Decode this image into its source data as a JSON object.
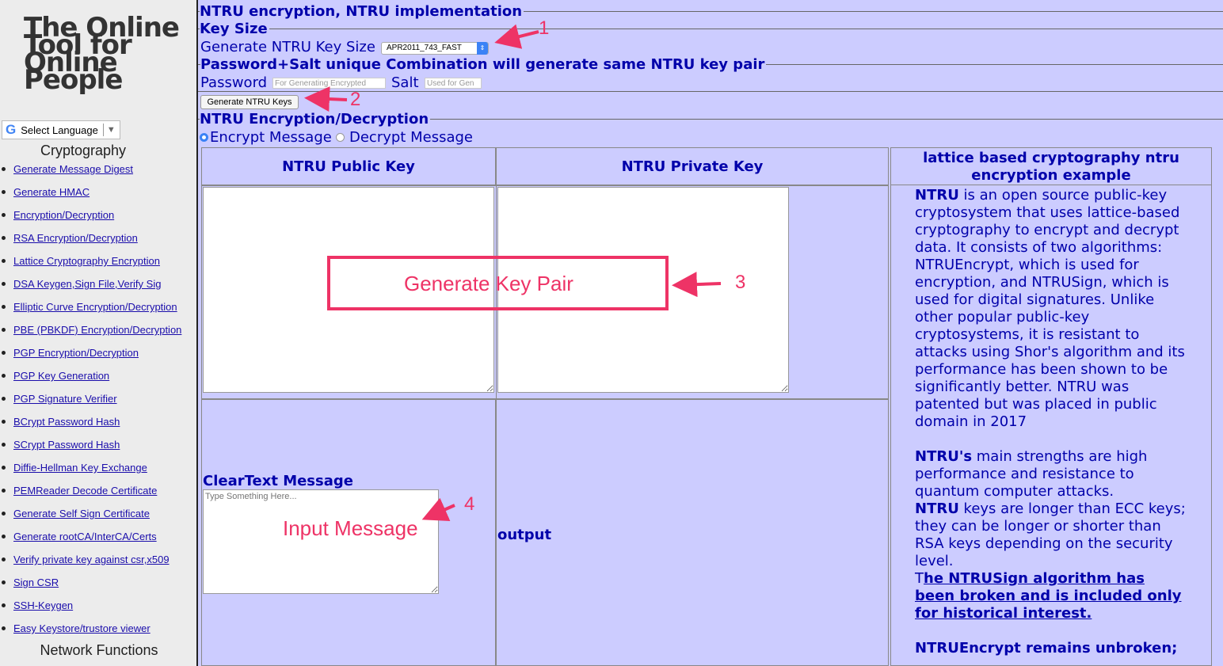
{
  "sidebar": {
    "logo_lines": [
      "The Online",
      "Tool for",
      "Online",
      "People"
    ],
    "language_label": "Select Language",
    "sections": [
      {
        "title": "Cryptography"
      },
      {
        "title": "Network Functions"
      }
    ],
    "items": [
      "Generate Message Digest",
      "Generate HMAC",
      "Encryption/Decryption",
      "RSA Encryption/Decryption",
      "Lattice Cryptography Encryption",
      "DSA Keygen,Sign File,Verify Sig",
      "Elliptic Curve Encryption/Decryption",
      "PBE (PBKDF) Encryption/Decryption",
      "PGP Encryption/Decryption",
      "PGP Key Generation",
      "PGP Signature Verifier",
      "BCrypt Password Hash",
      "SCrypt Password Hash",
      "Diffie-Hellman Key Exchange",
      "PEMReader Decode Certificate",
      "Generate Self Sign Certificate",
      "Generate rootCA/InterCA/Certs",
      "Verify private key against csr,x509",
      "Sign CSR",
      "SSH-Keygen",
      "Easy Keystore/trustore viewer"
    ]
  },
  "main": {
    "heading": "NTRU encryption, NTRU implementation",
    "key_size": {
      "legend": "Key Size",
      "label": "Generate NTRU Key Size",
      "selected": "APR2011_743_FAST"
    },
    "password_section": {
      "legend": "Password+Salt unique Combination will generate same NTRU key pair",
      "password_label": "Password",
      "password_placeholder": "For Generating Encrypted",
      "salt_label": "Salt",
      "salt_placeholder": "Used for Gen"
    },
    "generate_button": "Generate NTRU Keys",
    "encdec": {
      "legend": "NTRU Encryption/Decryption",
      "encrypt_label": "Encrypt Message",
      "decrypt_label": "Decrypt Message",
      "mode": "encrypt"
    },
    "table": {
      "public_key_header": "NTRU Public Key",
      "private_key_header": "NTRU Private Key",
      "info_header": "lattice based cryptography ntru encryption example",
      "cleartext_label": "ClearText Message",
      "cleartext_placeholder": "Type Something Here...",
      "output_label": "output"
    },
    "description": {
      "p1_bold": "NTRU",
      "p1": " is an open source public-key cryptosystem that uses lattice-based cryptography to encrypt and decrypt data. It consists of two algorithms: NTRUEncrypt, which is used for encryption, and NTRUSign, which is used for digital signatures. Unlike other popular public-key cryptosystems, it is resistant to attacks using Shor's algorithm and its performance has been shown to be significantly better. NTRU was patented but was placed in public domain in 2017",
      "p2_bold": "NTRU's",
      "p2": " main strengths are high performance and resistance to quantum computer attacks.",
      "p3_bold": "NTRU",
      "p3": " keys are longer than ECC keys; they can be longer or shorter than RSA keys depending on the security level.",
      "p4_prefix": "T",
      "p4_link": "he NTRUSign algorithm has been broken and is included only for historical interest.",
      "p5_bold": "NTRUEncrypt remains unbroken;"
    }
  },
  "annotations": {
    "n1": "1",
    "n2": "2",
    "n3": "3",
    "n4": "4",
    "generate_key_pair": "Generate Key Pair",
    "input_message": "Input Message",
    "color": "#ee3366"
  }
}
